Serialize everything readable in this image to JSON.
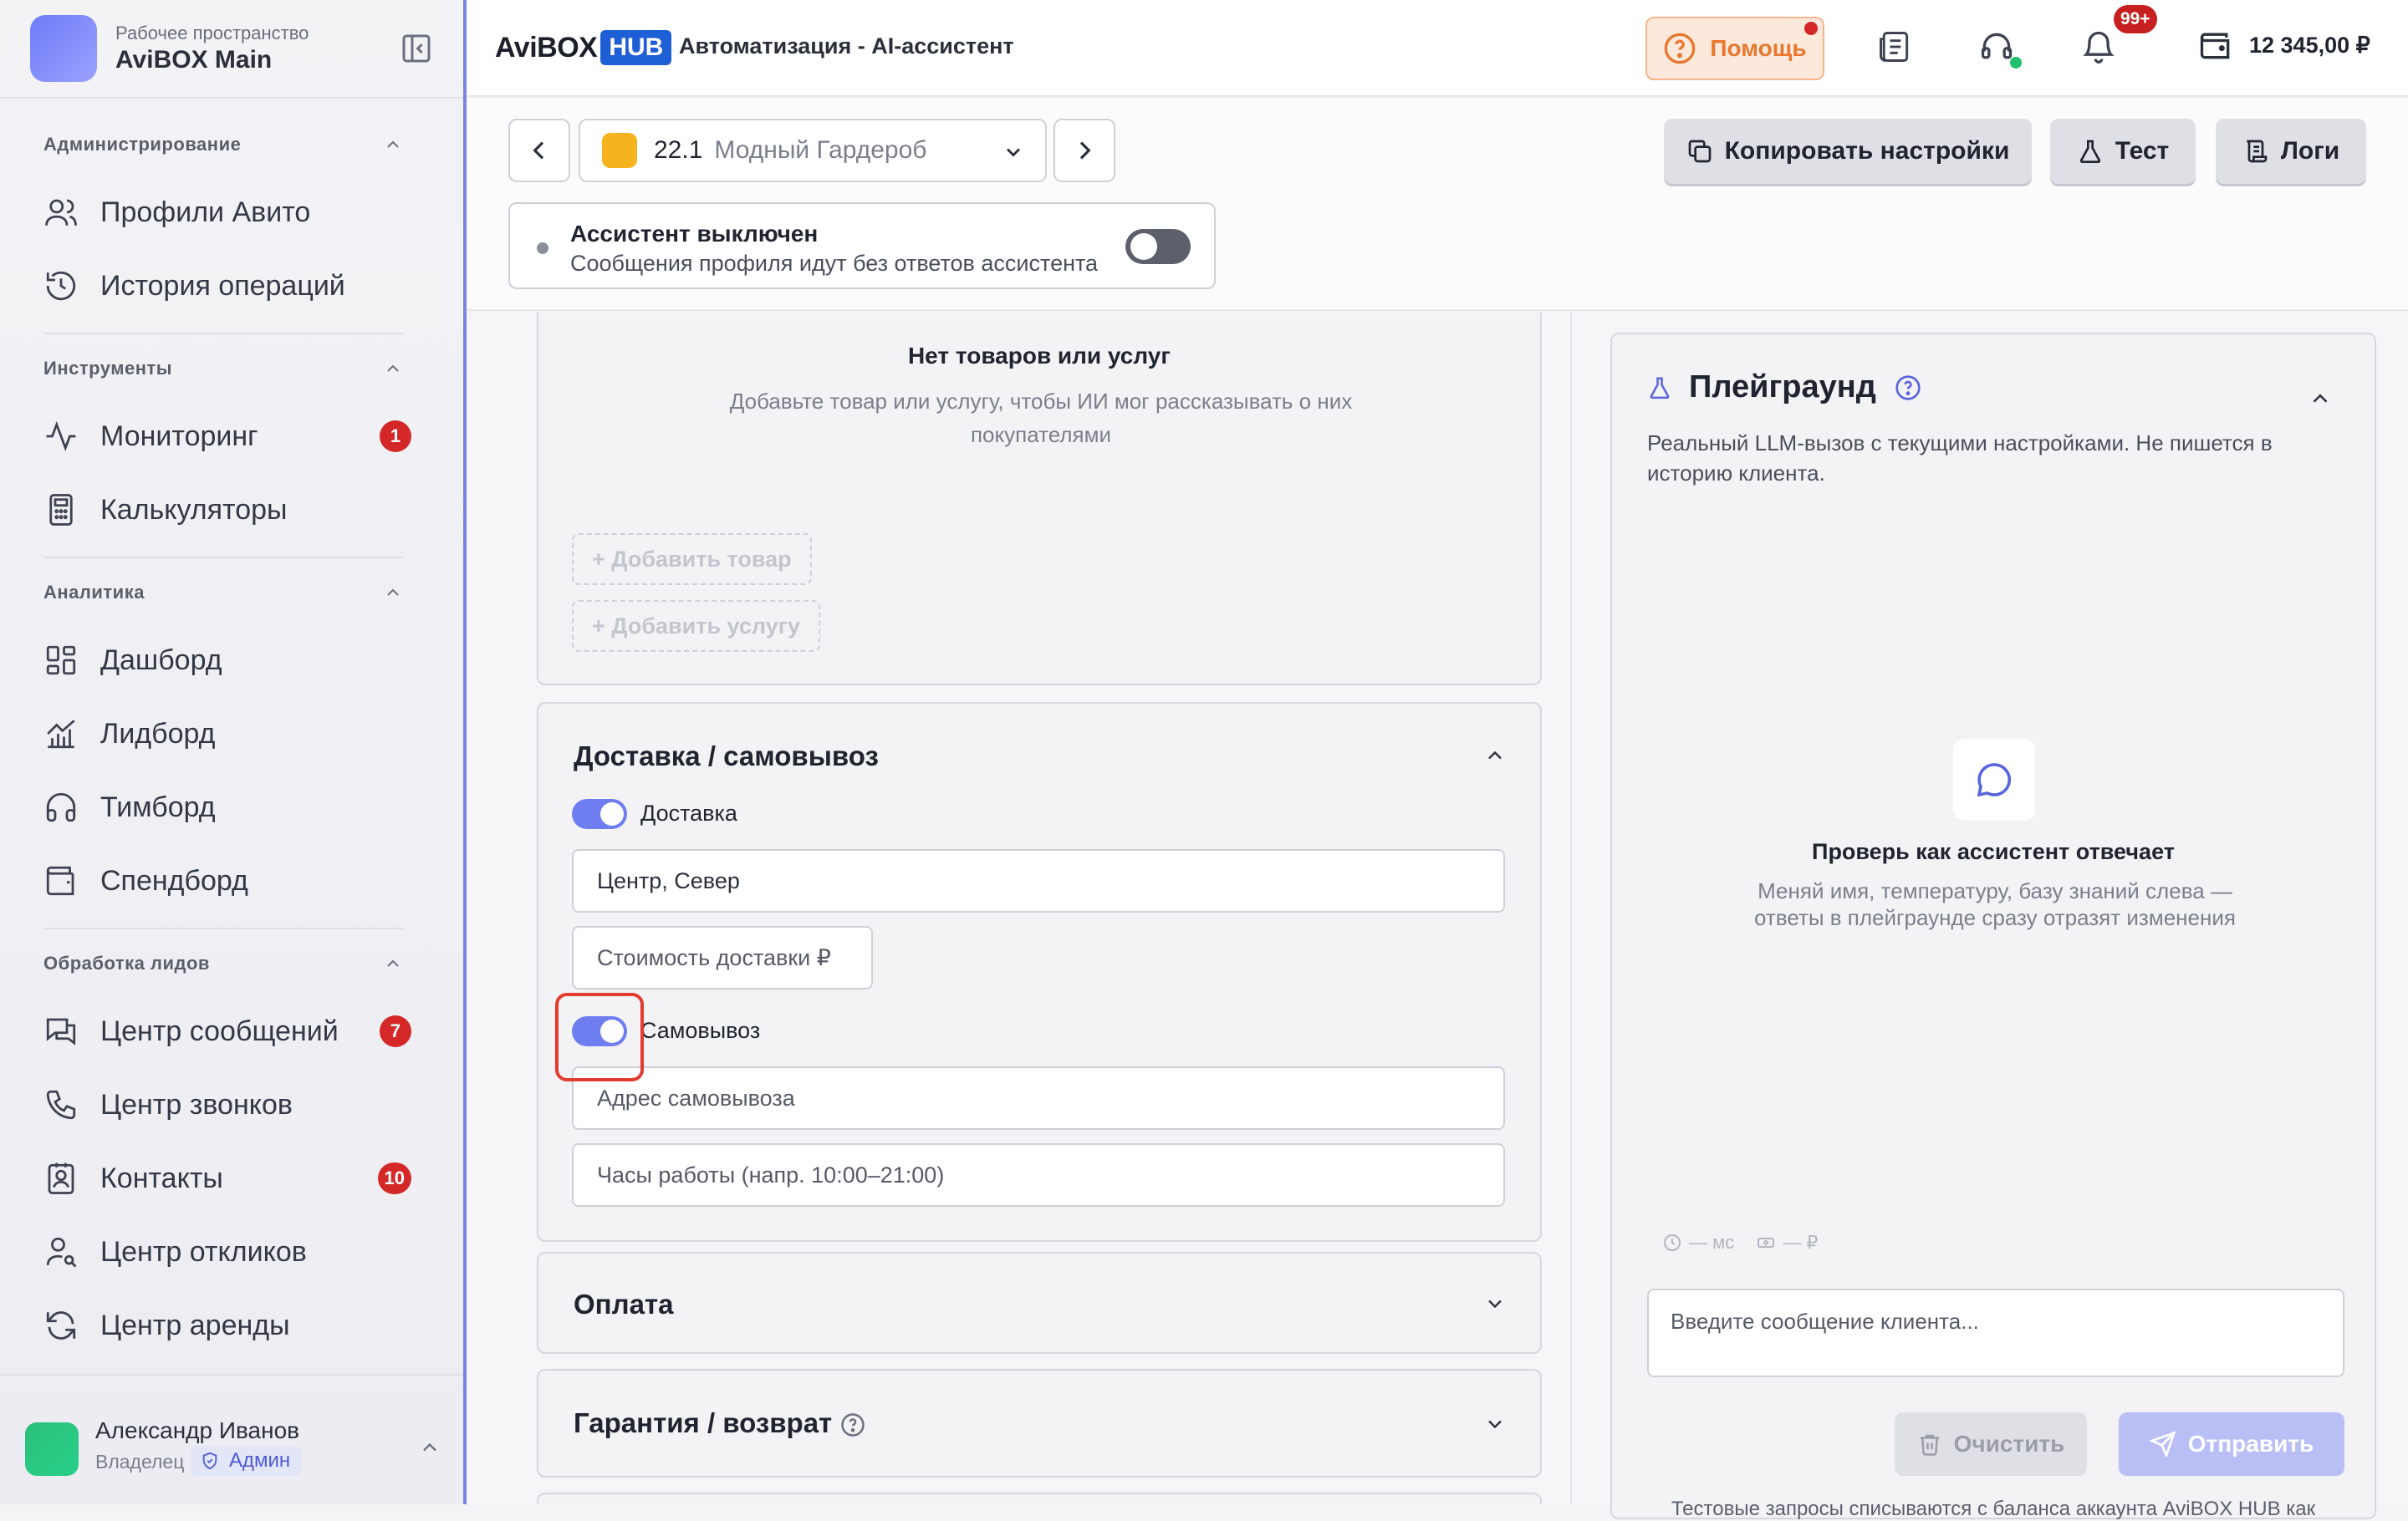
{
  "sidebar": {
    "workspace_label": "Рабочее пространство",
    "workspace_name": "AviBOX Main",
    "sections": {
      "admin": "Администрирование",
      "tools": "Инструменты",
      "analytics": "Аналитика",
      "leads": "Обработка лидов"
    },
    "items": {
      "avito_profiles": "Профили Авито",
      "ops_history": "История операций",
      "monitoring": "Мониторинг",
      "monitoring_badge": "1",
      "calculators": "Калькуляторы",
      "dashboard": "Дашборд",
      "leadboard": "Лидборд",
      "teamboard": "Тимборд",
      "spendboard": "Спендборд",
      "messages": "Центр сообщений",
      "messages_badge": "7",
      "calls": "Центр звонков",
      "contacts": "Контакты",
      "contacts_badge": "10",
      "responses": "Центр откликов",
      "rent": "Центр аренды"
    },
    "user": {
      "name": "Александр Иванов",
      "role": "Владелец",
      "badge": "Админ"
    }
  },
  "header": {
    "brand_left": "AviBOX",
    "brand_right": "HUB",
    "title": "Автоматизация - AI-ассистент",
    "help": "Помощь",
    "notif_badge": "99+",
    "balance": "12 345,00 ₽"
  },
  "toolbar": {
    "profile_num": "22.1",
    "profile_name": "Модный Гардероб",
    "copy": "Копировать настройки",
    "test": "Тест",
    "logs": "Логи",
    "assistant_title": "Ассистент выключен",
    "assistant_sub": "Сообщения профиля идут без ответов ассистента"
  },
  "products": {
    "empty_title": "Нет товаров или услуг",
    "empty_sub": "Добавьте товар или услугу, чтобы ИИ мог рассказывать о них покупателями",
    "add_product": "+ Добавить товар",
    "add_service": "+ Добавить услугу"
  },
  "delivery": {
    "title": "Доставка / самовывоз",
    "delivery_label": "Доставка",
    "delivery_zone": "Центр, Север",
    "delivery_cost": "Стоимость доставки ₽",
    "pickup_label": "Самовывоз",
    "pickup_address": "Адрес самовывоза",
    "work_hours": "Часы работы (напр. 10:00–21:00)"
  },
  "payment": {
    "title": "Оплата"
  },
  "warranty": {
    "title": "Гарантия / возврат"
  },
  "playground": {
    "title": "Плейграунд",
    "sub": "Реальный LLM-вызов с текущими настройками. Не пишется в историю клиента.",
    "empty_title": "Проверь как ассистент отвечает",
    "empty_sub": "Меняй имя, температуру, базу знаний слева — ответы в плейграунде сразу отразят изменения",
    "meta_time": "— мс",
    "meta_cost": "— ₽",
    "input_placeholder": "Введите сообщение клиента...",
    "clear": "Очистить",
    "send": "Отправить",
    "footer": "Тестовые запросы списываются с баланса аккаунта AviBOX HUB как"
  }
}
